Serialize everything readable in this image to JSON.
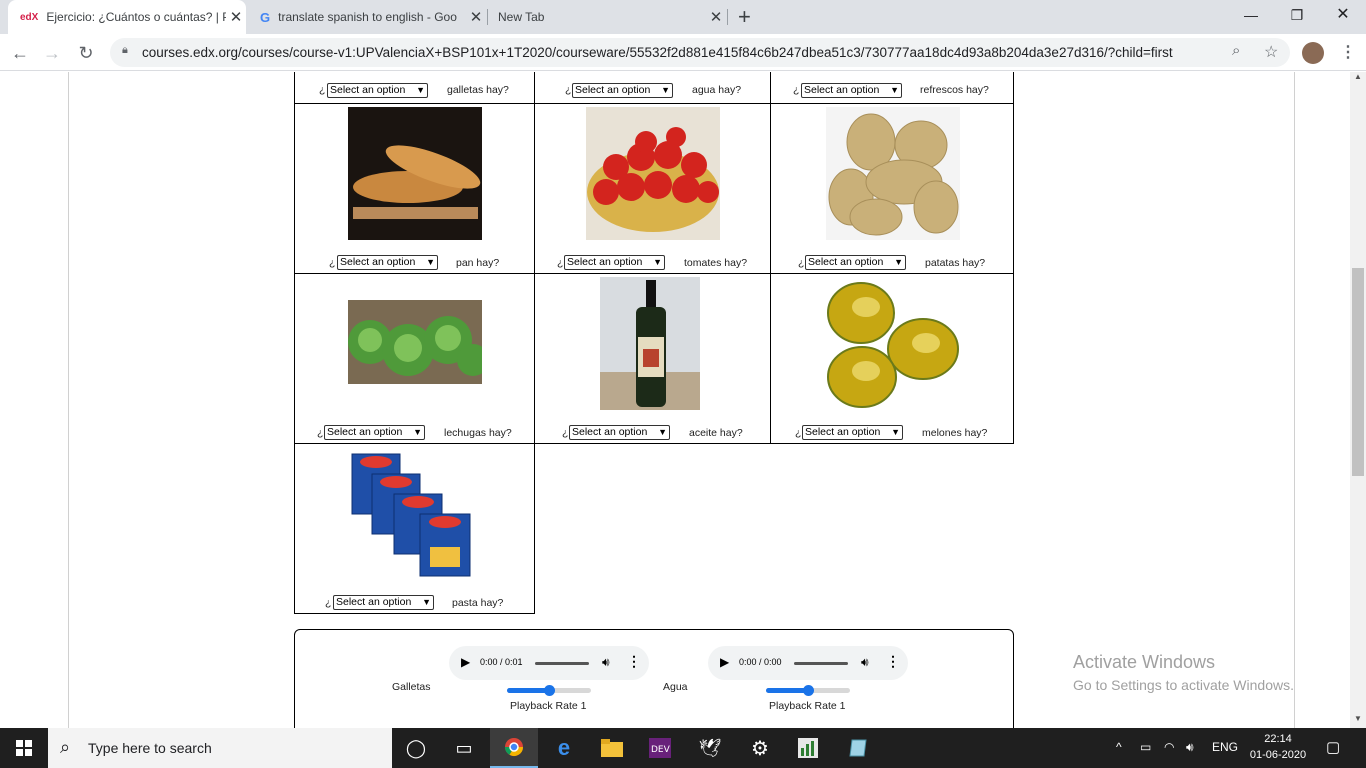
{
  "browser": {
    "tabs": [
      {
        "title": "Ejercicio: ¿Cuántos o cuántas? | P",
        "favicon": "edx-icon",
        "active": true
      },
      {
        "title": "translate spanish to english - Goo",
        "favicon": "google-icon",
        "active": false
      },
      {
        "title": "New Tab",
        "favicon": "",
        "active": false
      }
    ],
    "new_tab": "+",
    "url": "courses.edx.org/courses/course-v1:UPValenciaX+BSP101x+1T2020/courseware/55532f2d881e415f84c6b247dbea51c3/730777aa18dc4d93a8b204da3e27d316/?child=first"
  },
  "quiz": {
    "prefix": "¿",
    "placeholder": "Select an option",
    "row0": [
      {
        "noun": "galletas hay?"
      },
      {
        "noun": "agua hay?"
      },
      {
        "noun": "refrescos hay?"
      }
    ],
    "row1": [
      {
        "noun": "pan hay?"
      },
      {
        "noun": "tomates hay?"
      },
      {
        "noun": "patatas hay?"
      }
    ],
    "row2": [
      {
        "noun": "lechugas hay?"
      },
      {
        "noun": "aceite hay?"
      },
      {
        "noun": "melones hay?"
      }
    ],
    "row3": [
      {
        "noun": "pasta hay?"
      }
    ]
  },
  "audio": [
    {
      "label": "Galletas",
      "time": "0:00 / 0:01",
      "rate_label": "Playback Rate 1",
      "rate_fraction": 0.5
    },
    {
      "label": "Agua",
      "time": "0:00 / 0:00",
      "rate_label": "Playback Rate 1",
      "rate_fraction": 0.5
    }
  ],
  "activate": {
    "title": "Activate Windows",
    "subtitle": "Go to Settings to activate Windows."
  },
  "taskbar": {
    "search_placeholder": "Type here to search",
    "lang": "ENG",
    "time": "22:14",
    "date": "01-06-2020"
  }
}
